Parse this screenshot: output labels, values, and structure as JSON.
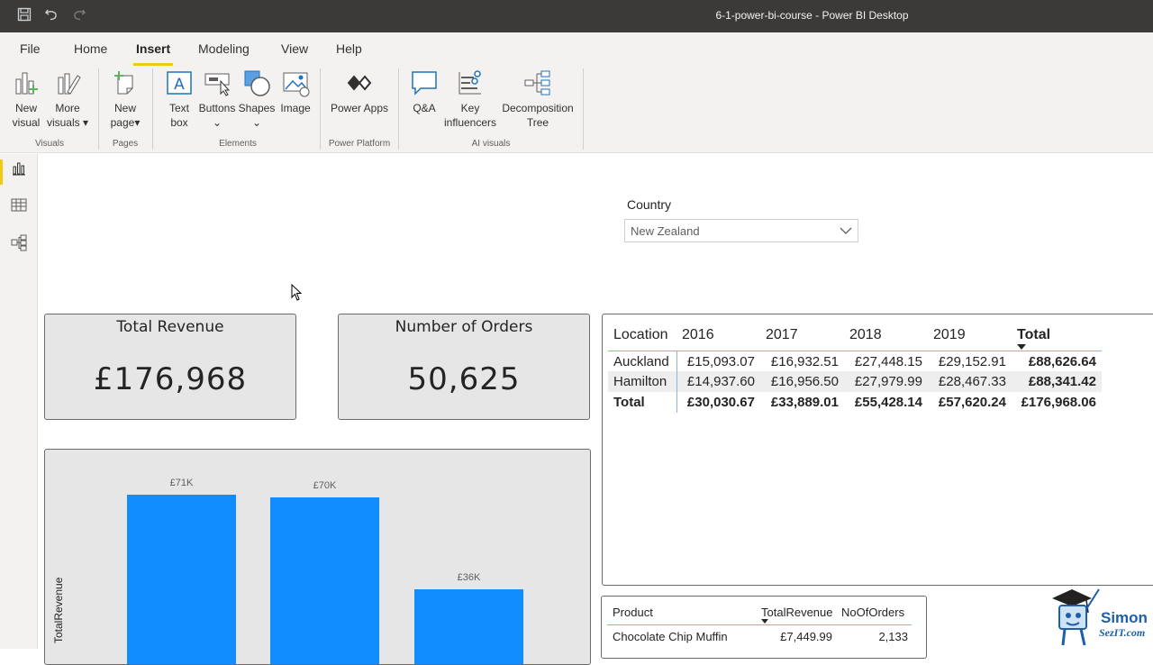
{
  "window": {
    "title": "6-1-power-bi-course - Power BI Desktop"
  },
  "tabs": [
    "File",
    "Home",
    "Insert",
    "Modeling",
    "View",
    "Help"
  ],
  "ribbon": {
    "new_visual": [
      "New",
      "visual"
    ],
    "more_visuals": [
      "More",
      "visuals"
    ],
    "new_page": [
      "New",
      "page"
    ],
    "text_box": [
      "Text",
      "box"
    ],
    "buttons": "Buttons",
    "shapes": "Shapes",
    "image": "Image",
    "power_apps": "Power Apps",
    "qna": "Q&A",
    "key_influencers": [
      "Key",
      "influencers"
    ],
    "decomposition_tree": [
      "Decomposition",
      "Tree"
    ],
    "groups": {
      "visuals": "Visuals",
      "pages": "Pages",
      "elements": "Elements",
      "power_platform": "Power Platform",
      "ai_visuals": "AI visuals"
    }
  },
  "slicer": {
    "label": "Country",
    "value": "New Zealand"
  },
  "cards": [
    {
      "title": "Total Revenue",
      "value": "£176,968"
    },
    {
      "title": "Number of Orders",
      "value": "50,625"
    }
  ],
  "matrix": {
    "headers": [
      "Location",
      "2016",
      "2017",
      "2018",
      "2019",
      "Total"
    ],
    "rows": [
      [
        "Auckland",
        "£15,093.07",
        "£16,932.51",
        "£27,448.15",
        "£29,152.91",
        "£88,626.64"
      ],
      [
        "Hamilton",
        "£14,937.60",
        "£16,956.50",
        "£27,979.99",
        "£28,467.33",
        "£88,341.42"
      ],
      [
        "Total",
        "£30,030.67",
        "£33,889.01",
        "£55,428.14",
        "£57,620.24",
        "£176,968.06"
      ]
    ]
  },
  "chart_data": {
    "type": "bar",
    "ylabel": "TotalRevenue",
    "values": [
      71,
      70,
      36
    ],
    "data_labels": [
      "£71K",
      "£70K",
      "£36K"
    ],
    "unit": "£K"
  },
  "product_table": {
    "headers": [
      "Product",
      "TotalRevenue",
      "NoOfOrders"
    ],
    "rows": [
      [
        "Chocolate Chip Muffin",
        "£7,449.99",
        "2,133"
      ]
    ]
  },
  "logo": {
    "line1": "Simon",
    "line2": "SezIT.com"
  },
  "colors": {
    "accent": "#f2c811",
    "bar": "#118dff",
    "titlebar": "#3b3a39"
  }
}
